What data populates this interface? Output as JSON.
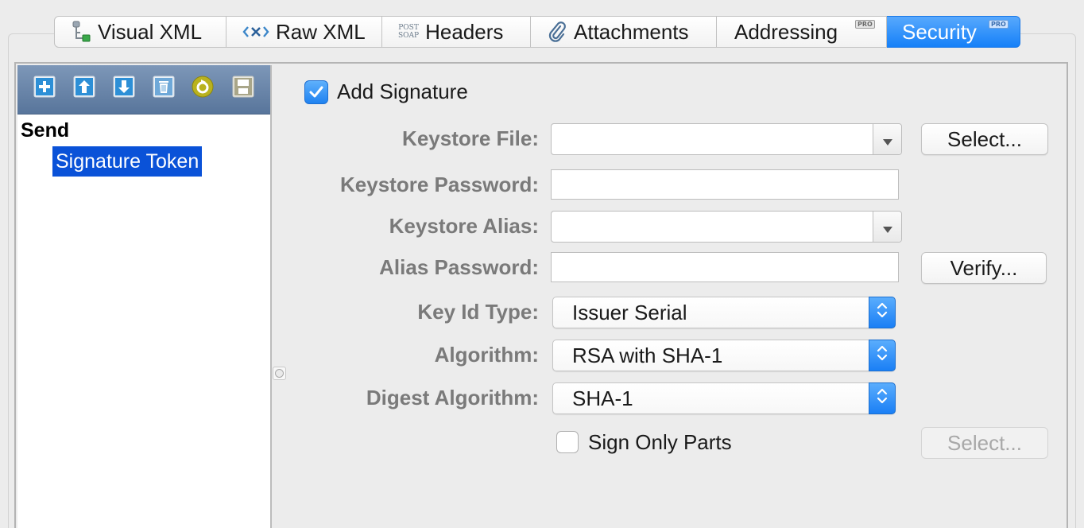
{
  "tabs": [
    {
      "label": "Visual XML",
      "icon": "tree-icon",
      "pro": false,
      "active": false
    },
    {
      "label": "Raw XML",
      "icon": "xml-tag-icon",
      "pro": false,
      "active": false
    },
    {
      "label": "Headers",
      "icon": "post-soap-icon",
      "icon_text_top": "POST",
      "icon_text_bottom": "SOAP",
      "pro": false,
      "active": false
    },
    {
      "label": "Attachments",
      "icon": "paperclip-icon",
      "pro": false,
      "active": false
    },
    {
      "label": "Addressing",
      "icon": null,
      "pro": true,
      "active": false
    },
    {
      "label": "Security",
      "icon": null,
      "pro": true,
      "active": true
    }
  ],
  "pro_badge_text": "PRO",
  "toolbar": {
    "buttons": [
      "add-icon",
      "move-up-icon",
      "move-down-icon",
      "delete-icon",
      "reload-icon",
      "save-icon"
    ]
  },
  "tree": {
    "root_label": "Send",
    "children": [
      {
        "label": "Signature Token",
        "selected": true
      }
    ]
  },
  "form": {
    "add_signature": {
      "label": "Add Signature",
      "checked": true
    },
    "keystore_file": {
      "label": "Keystore File:",
      "value": ""
    },
    "keystore_password": {
      "label": "Keystore Password:",
      "value": ""
    },
    "keystore_alias": {
      "label": "Keystore Alias:",
      "value": ""
    },
    "alias_password": {
      "label": "Alias Password:",
      "value": ""
    },
    "key_id_type": {
      "label": "Key Id Type:",
      "value": "Issuer Serial"
    },
    "algorithm": {
      "label": "Algorithm:",
      "value": "RSA with SHA-1"
    },
    "digest_algorithm": {
      "label": "Digest Algorithm:",
      "value": "SHA-1"
    },
    "sign_only_parts": {
      "label": "Sign Only Parts",
      "checked": false
    },
    "select_keystore_button": "Select...",
    "verify_button": "Verify...",
    "select_parts_button": {
      "label": "Select...",
      "enabled": false
    }
  },
  "colors": {
    "accent": "#1a7ff5",
    "selection": "#0a52d8",
    "toolbar_top": "#7d97b8",
    "toolbar_bottom": "#58759b",
    "label_gray": "#7a7a7a"
  }
}
